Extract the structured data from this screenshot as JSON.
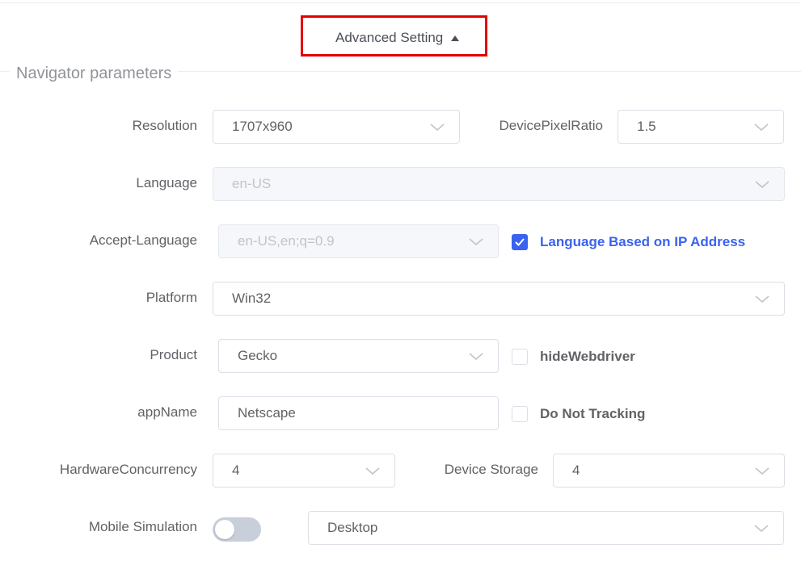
{
  "advanced": {
    "label": "Advanced Setting"
  },
  "section": {
    "title": "Navigator parameters"
  },
  "fields": {
    "resolution": {
      "label": "Resolution",
      "value": "1707x960"
    },
    "device_pixel_ratio": {
      "label": "DevicePixelRatio",
      "value": "1.5"
    },
    "language": {
      "label": "Language",
      "value": "en-US"
    },
    "accept_language": {
      "label": "Accept-Language",
      "value": "en-US,en;q=0.9"
    },
    "language_ip": {
      "label": "Language Based on IP Address",
      "checked": true
    },
    "platform": {
      "label": "Platform",
      "value": "Win32"
    },
    "product": {
      "label": "Product",
      "value": "Gecko"
    },
    "hide_webdriver": {
      "label": "hideWebdriver",
      "checked": false
    },
    "app_name": {
      "label": "appName",
      "value": "Netscape"
    },
    "do_not_tracking": {
      "label": "Do Not Tracking",
      "checked": false
    },
    "hardware_concurrency": {
      "label": "HardwareConcurrency",
      "value": "4"
    },
    "device_storage": {
      "label": "Device Storage",
      "value": "4"
    },
    "mobile_simulation": {
      "label": "Mobile Simulation",
      "enabled": false,
      "mode": "Desktop"
    }
  },
  "colors": {
    "accent": "#3a62f0",
    "highlight_box": "#e50000"
  },
  "icons": {
    "dropdown": "chevron-down-icon",
    "expand": "caret-up-icon",
    "check": "check-icon"
  }
}
